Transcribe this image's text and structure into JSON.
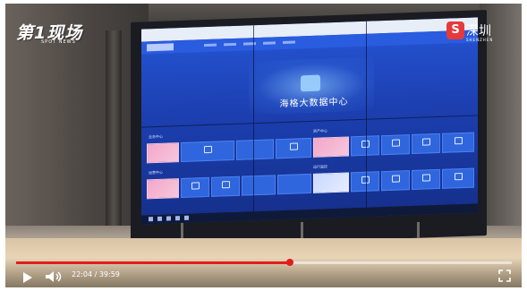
{
  "overlay": {
    "left_logo_text": "第1现场",
    "left_logo_sub": "SPOT NEWS",
    "right_logo_badge": "S",
    "right_logo_text": "深圳",
    "right_logo_sub": "SHENZHEN"
  },
  "screen": {
    "hero_title": "海格大数据中心",
    "section_labels": [
      "业务中心",
      "资产中心",
      "运营中心",
      "运行监控"
    ]
  },
  "player": {
    "current_time": "22:04",
    "separator": " / ",
    "duration": "39:59",
    "progress_fraction": 0.5518,
    "accent_color": "#e21d1d",
    "icons": [
      "play-icon",
      "volume-icon",
      "fullscreen-icon"
    ]
  }
}
